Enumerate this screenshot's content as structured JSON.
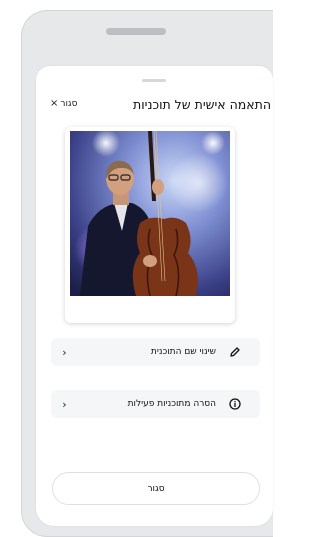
{
  "sheet": {
    "title": "התאמה אישית של תוכניות",
    "close_label": "סגור",
    "close_icon": "×"
  },
  "menu": [
    {
      "label": "שינוי שם התוכנית",
      "icon": "pencil-icon"
    },
    {
      "label": "הסרה מתוכניות פעילות",
      "icon": "info-icon"
    }
  ],
  "footer": {
    "close_button_label": "סגור"
  },
  "colors": {
    "frame": "#e7e8ea",
    "sheet": "#ffffff",
    "row_bg": "#f5f6f7"
  }
}
